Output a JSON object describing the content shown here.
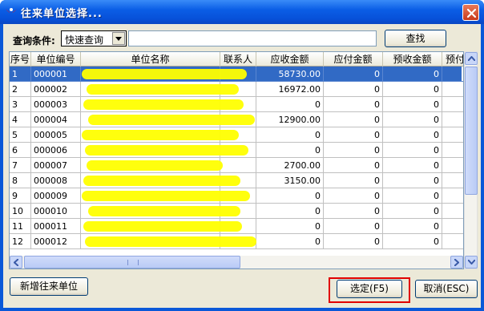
{
  "window": {
    "title": "往来单位选择..."
  },
  "query": {
    "label": "查询条件:",
    "mode": "快速查询",
    "search_value": "",
    "search_button": "查找"
  },
  "colors": {
    "highlight": "#ffff00",
    "selection": "#316ac5",
    "annotation": "#e00000"
  },
  "table": {
    "columns": [
      "序号",
      "单位编号",
      "单位名称",
      "联系人",
      "应收金额",
      "应付金额",
      "预收金额",
      "预付"
    ],
    "rows": [
      [
        "1",
        "000001",
        "",
        "",
        "58730.00",
        "0",
        "0"
      ],
      [
        "2",
        "000002",
        "",
        "",
        "16972.00",
        "0",
        "0"
      ],
      [
        "3",
        "000003",
        "",
        "",
        "0",
        "0",
        "0"
      ],
      [
        "4",
        "000004",
        "",
        "",
        "12900.00",
        "0",
        "0"
      ],
      [
        "5",
        "000005",
        "",
        "",
        "0",
        "0",
        "0"
      ],
      [
        "6",
        "000006",
        "",
        "",
        "0",
        "0",
        "0"
      ],
      [
        "7",
        "000007",
        "",
        "",
        "2700.00",
        "0",
        "0"
      ],
      [
        "8",
        "000008",
        "",
        "",
        "3150.00",
        "0",
        "0"
      ],
      [
        "9",
        "000009",
        "",
        "",
        "0",
        "0",
        "0"
      ],
      [
        "10",
        "000010",
        "",
        "",
        "0",
        "0",
        "0"
      ],
      [
        "11",
        "000011",
        "",
        "",
        "0",
        "0",
        "0"
      ],
      [
        "12",
        "000012",
        "",
        "",
        "0",
        "0",
        "0"
      ]
    ],
    "selected_row": 1
  },
  "buttons": {
    "add_partner": "新增往来单位",
    "confirm": "选定(F5)",
    "cancel": "取消(ESC)"
  },
  "icons": {
    "app": "app-logo-icon",
    "close": "close-icon",
    "dropdown": "chevron-down-icon"
  }
}
